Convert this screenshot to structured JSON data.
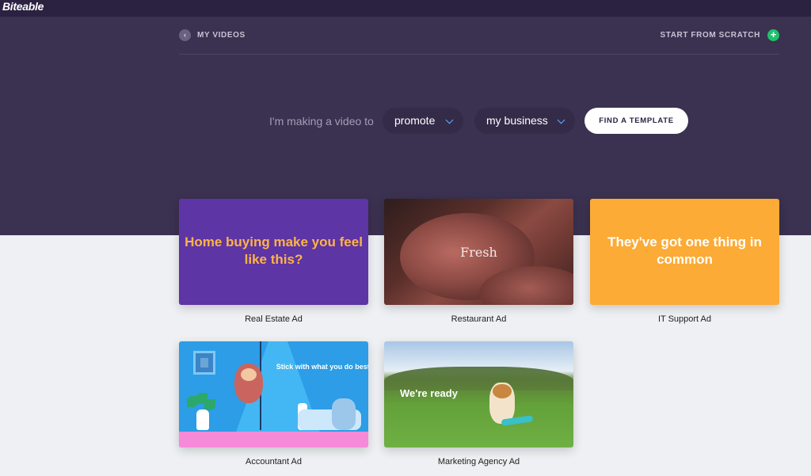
{
  "app": {
    "logo": "Biteable"
  },
  "subnav": {
    "back_label": "MY VIDEOS",
    "back_icon": "chevron-left-icon",
    "scratch_label": "START FROM SCRATCH",
    "scratch_icon": "plus-icon"
  },
  "maker": {
    "label": "I'm making a video to",
    "purpose_value": "promote",
    "audience_value": "my business",
    "find_button": "FIND A TEMPLATE"
  },
  "colors": {
    "hero_bg": "#3b3150",
    "topbar_bg": "#2a2240",
    "accent_green": "#1fc26b",
    "dropdown_chevron": "#5db0ff"
  },
  "templates": [
    {
      "thumb_text": "Home buying make you feel like this?",
      "caption": "Real Estate Ad"
    },
    {
      "thumb_text": "Fresh",
      "caption": "Restaurant Ad"
    },
    {
      "thumb_text": "They've got one thing in common",
      "caption": "IT Support Ad"
    },
    {
      "thumb_text": "Stick with what you do best.",
      "caption": "Accountant Ad"
    },
    {
      "thumb_text": "We're ready",
      "caption": "Marketing Agency Ad"
    }
  ]
}
